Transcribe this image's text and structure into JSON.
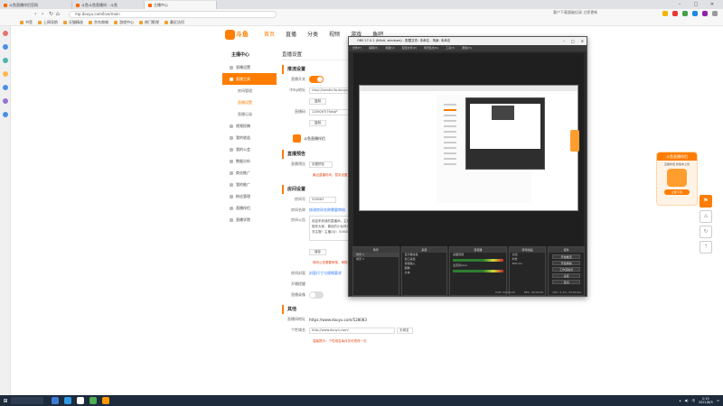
{
  "browser": {
    "tabs": [
      "斗鱼直播伴侣官网",
      "斗鱼斗鱼直播间 - 斗鱼",
      "主播中心"
    ],
    "url": "mp.douyu.com/live/main",
    "search_hint": "客户下载量破纪录 立即更新",
    "bookmarks": [
      "书签",
      "上网导航",
      "天猫精选",
      "京东商城",
      "游戏中心",
      "热门影视",
      "最近访问"
    ]
  },
  "site": {
    "nav": [
      "首页",
      "直播",
      "分类",
      "视频",
      "游戏",
      "鱼吧"
    ]
  },
  "sidebar": {
    "title": "主播中心",
    "items": [
      {
        "label": "直播设置",
        "kind": "item"
      },
      {
        "label": "直播工具",
        "kind": "active"
      },
      {
        "label": "房间管理",
        "kind": "sub"
      },
      {
        "label": "直播设置",
        "kind": "sub-current"
      },
      {
        "label": "直播记录",
        "kind": "sub"
      },
      {
        "label": "视频投稿",
        "kind": "item"
      },
      {
        "label": "我的收益",
        "kind": "item"
      },
      {
        "label": "我的公会",
        "kind": "item"
      },
      {
        "label": "数据分析",
        "kind": "item"
      },
      {
        "label": "商业推广",
        "kind": "item"
      },
      {
        "label": "我的推广",
        "kind": "item"
      },
      {
        "label": "粉丝管理",
        "kind": "item"
      },
      {
        "label": "直播伴侣",
        "kind": "item"
      },
      {
        "label": "直播学院",
        "kind": "item"
      }
    ]
  },
  "content": {
    "page_title": "直播设置",
    "section_push": "推流设置",
    "live_switch_label": "直播开关",
    "rtmp_label": "rtmp地址",
    "rtmp_value": "rtmp://sendtc3a.douyu.com/live",
    "copy_button": "复制",
    "code_label": "直播码",
    "code_value": "128926Ti7fakqP",
    "notice_text": "斗鱼直播伴侣",
    "section_preview": "直播预告",
    "preview_label": "直播预告",
    "preview_button": "设置预告",
    "preview_hint": "最近直播时间，暂未设置",
    "section_room": "房间设置",
    "room_no_label": "房间号",
    "room_no_value": "528083",
    "room_name_label": "房间名称",
    "room_name_hint": "修改房间名称需要审核",
    "room_intro_label": "房间公告",
    "room_intro_value": "欢迎来到我的直播间，主播会一直陪伴大家，喜欢的小伙伴记得点个关注哦！主播QQ：5164576",
    "save_button": "保存",
    "intro_hint": "修改公告需要审核，审核通过后才会在直播间显示",
    "cover_label": "房间封面",
    "cover_link": "封面尺寸与规格要求",
    "cover_button": "上传",
    "notify_label": "开播提醒",
    "rec_label": "直播录像",
    "section_other": "其他",
    "share_label": "直播间地址",
    "share_value": "https://www.douyu.com/528083",
    "embed_label": "个性域名",
    "embed_value": "http://www.douyu.com/",
    "embed_select": "无域名",
    "embed_hint": "温馨提示：个性域名每月仅可修改一次"
  },
  "float_ad": {
    "title": "斗鱼直播伴侣",
    "subtitle": "直播伴侣 新版本上线",
    "button": "立即下载"
  },
  "obs": {
    "title": "OBS 27.0.1 (64bit, windows) - 配置文件: 未命名 - 场景: 未命名",
    "menu": [
      "文件(F)",
      "编辑(E)",
      "视图(V)",
      "配置文件(P)",
      "场景集合(S)",
      "工具(T)",
      "帮助(H)"
    ],
    "docks": {
      "scenes": {
        "header": "场景",
        "items": [
          "场景 2",
          "场景 3"
        ]
      },
      "sources": {
        "header": "来源",
        "items": [
          "显示器采集",
          "窗口采集",
          "音频输入",
          "图像",
          "文本"
        ]
      },
      "mixer": {
        "header": "混音器",
        "items": [
          "桌面音频",
          "麦克风/Aux"
        ]
      },
      "transitions": {
        "header": "转场动画",
        "fade": "淡出",
        "duration_label": "时长",
        "duration_value": "300 ms"
      },
      "controls": {
        "header": "控件",
        "buttons": [
          "开始推流",
          "开始录制",
          "工作室模式",
          "设置",
          "退出"
        ]
      }
    },
    "status": [
      "LIVE: 00:00:00",
      "REC: 00:00:00",
      "CPU: 2.1%, 30.00 fps"
    ]
  },
  "taskbar": {
    "time": "2:15",
    "date": "2021/8/9",
    "lang": "中"
  },
  "colors": {
    "brand": "#ff7d00",
    "obs_bg": "#2b2b2b",
    "taskbar": "#1e2b3c"
  }
}
